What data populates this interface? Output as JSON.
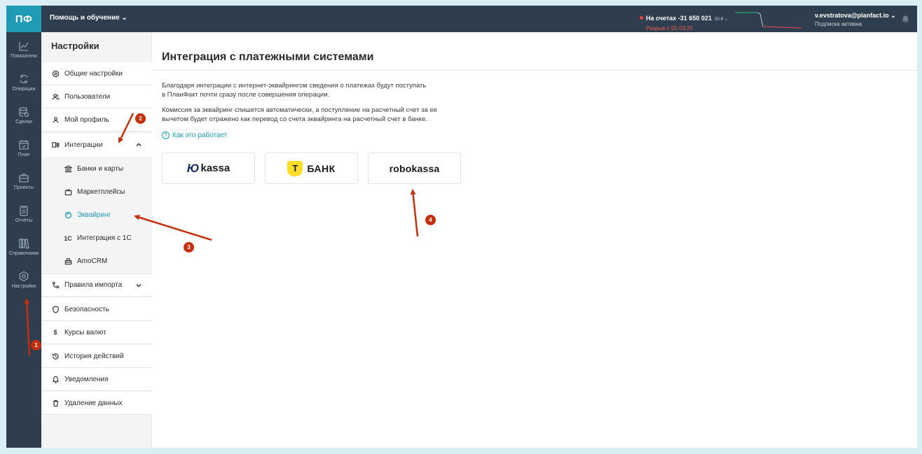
{
  "app": {
    "logo": "ПФ",
    "help_menu": "Помощь и обучение ⌄"
  },
  "rail": {
    "items": [
      {
        "label": "Показатели",
        "icon": "chart-line-icon"
      },
      {
        "label": "Операции",
        "icon": "refresh-icon"
      },
      {
        "label": "Сделки",
        "icon": "coins-icon"
      },
      {
        "label": "План",
        "icon": "calendar-icon"
      },
      {
        "label": "Проекты",
        "icon": "briefcase-icon"
      },
      {
        "label": "Отчёты",
        "icon": "clipboard-icon"
      },
      {
        "label": "Справочники",
        "icon": "books-icon"
      },
      {
        "label": "Настройки",
        "icon": "gear-icon"
      }
    ]
  },
  "topbar": {
    "balance_label": "На счетах -31 650 021",
    "balance_cents": "50 ₽ ⌄",
    "balance_gap": "Разрыв с 05.03.25",
    "user_email": "v.evstratova@planfact.io ⌄",
    "user_status": "Подписка активна"
  },
  "settings": {
    "title": "Настройки",
    "items": [
      {
        "label": "Общие настройки",
        "icon": "gear-icon"
      },
      {
        "label": "Пользователи",
        "icon": "users-icon"
      },
      {
        "label": "Мой профиль",
        "icon": "user-icon"
      },
      {
        "label": "Интеграции",
        "icon": "integrations-icon"
      },
      {
        "label": "Банки и карты",
        "icon": "bank-icon"
      },
      {
        "label": "Маркетплейсы",
        "icon": "bag-icon"
      },
      {
        "label": "Эквайринг",
        "icon": "acquiring-icon"
      },
      {
        "label": "Интеграция с 1С",
        "icon": "1c-icon",
        "icon_text": "1С"
      },
      {
        "label": "AmoCRM",
        "icon": "amocrm-icon"
      },
      {
        "label": "Правила импорта",
        "icon": "rules-icon"
      },
      {
        "label": "Безопасность",
        "icon": "shield-icon"
      },
      {
        "label": "Курсы валют",
        "icon": "dollar-icon",
        "icon_text": "$"
      },
      {
        "label": "История действий",
        "icon": "history-icon"
      },
      {
        "label": "Уведомления",
        "icon": "bell-icon"
      },
      {
        "label": "Удаление данных",
        "icon": "trash-icon"
      }
    ]
  },
  "main": {
    "title": "Интеграция с платежными системами",
    "para1_line1": "Благодаря интеграции с интернет-эквайрингом сведения о платежах будут поступать",
    "para1_line2": "в ПланФакт почти сразу после совершения операции.",
    "para2_line1": "Комиссия за эквайринг спишется автоматически, а поступление на расчетный счет за ее",
    "para2_line2": "вычетом будет отражено как перевод со счета эквайринга на расчетный счет в банке.",
    "how_link": "Как это работает",
    "cards": [
      {
        "mark": "Ю",
        "name": "kassa"
      },
      {
        "mark": "Т",
        "name": "БАНК"
      },
      {
        "name": "robokassa"
      }
    ]
  },
  "annotations": [
    "1",
    "2",
    "3",
    "4"
  ],
  "colors": {
    "accent": "#1f9bb6",
    "dark": "#2e3e4f",
    "marker": "#c3300f",
    "negative": "#e6463e"
  }
}
